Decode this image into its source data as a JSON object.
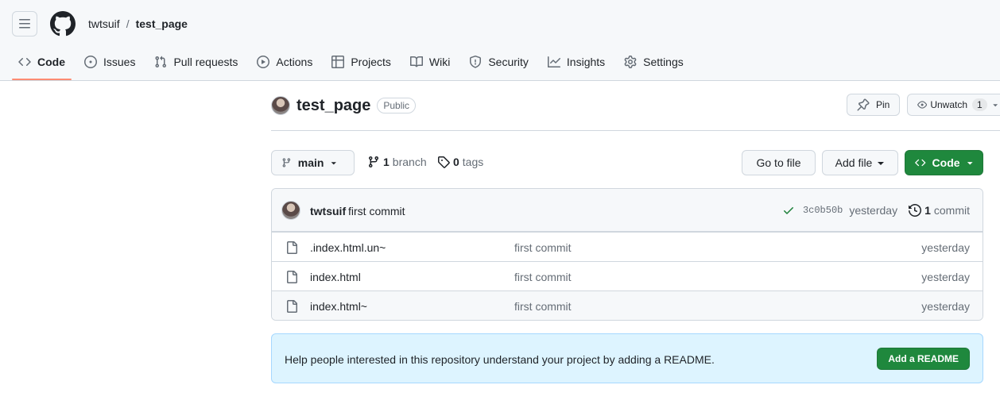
{
  "header": {
    "owner": "twtsuif",
    "separator": "/",
    "repo": "test_page"
  },
  "tabs": [
    {
      "label": "Code",
      "icon": "code-icon",
      "active": true
    },
    {
      "label": "Issues",
      "icon": "issue-icon"
    },
    {
      "label": "Pull requests",
      "icon": "pull-request-icon"
    },
    {
      "label": "Actions",
      "icon": "play-icon"
    },
    {
      "label": "Projects",
      "icon": "table-icon"
    },
    {
      "label": "Wiki",
      "icon": "book-icon"
    },
    {
      "label": "Security",
      "icon": "shield-icon"
    },
    {
      "label": "Insights",
      "icon": "graph-icon"
    },
    {
      "label": "Settings",
      "icon": "gear-icon"
    }
  ],
  "repo": {
    "name": "test_page",
    "visibility": "Public",
    "pin_label": "Pin",
    "watch_label": "Unwatch",
    "watch_count": "1"
  },
  "branch_bar": {
    "current_branch": "main",
    "branch_count": "1",
    "branch_label": "branch",
    "tag_count": "0",
    "tag_label": "tags",
    "goto_file": "Go to file",
    "add_file": "Add file",
    "code": "Code"
  },
  "latest_commit": {
    "author": "twtsuif",
    "message": "first commit",
    "sha": "3c0b50b",
    "when": "yesterday",
    "commit_count": "1",
    "commit_label": "commit"
  },
  "files": [
    {
      "name": ".index.html.un~",
      "message": "first commit",
      "when": "yesterday"
    },
    {
      "name": "index.html",
      "message": "first commit",
      "when": "yesterday"
    },
    {
      "name": "index.html~",
      "message": "first commit",
      "when": "yesterday"
    }
  ],
  "readme_banner": {
    "text": "Help people interested in this repository understand your project by adding a README.",
    "button": "Add a README"
  },
  "colors": {
    "primary_green": "#1f883d",
    "active_tab_underline": "#fd8c73",
    "readme_bg": "#ddf4ff",
    "check_green": "#1a7f37"
  }
}
